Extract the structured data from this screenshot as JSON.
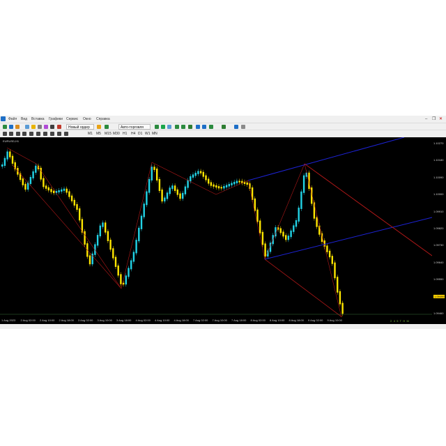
{
  "menu": {
    "items": [
      "Файл",
      "Вид",
      "Вставка",
      "Графики",
      "Сервис",
      "Окно",
      "Справка"
    ]
  },
  "window_controls": {
    "minimize": "–",
    "restore": "❐",
    "close": "✕"
  },
  "toolbar": {
    "new_order_label": "Новый ордер",
    "auto_trading_label": "Авто-торговля",
    "timeframes": [
      "M1",
      "M5",
      "M15",
      "M30",
      "H1",
      "H4",
      "D1",
      "W1",
      "MN"
    ]
  },
  "chart": {
    "symbol_title": "EURUSD,H1",
    "background": "#000000",
    "bull_color": "#22d3e6",
    "bear_color": "#ffe600",
    "channel_color": "#1d23d6",
    "line_color": "#b01818",
    "current_price": "1.09499"
  },
  "price_scale": [
    "1.10270",
    "1.10180",
    "1.10090",
    "1.10000",
    "1.09910",
    "1.09820",
    "1.09730",
    "1.09640",
    "1.09550",
    "1.09499",
    "1.09460"
  ],
  "time_scale": [
    "1 Aug 2023",
    "2 Aug 02:00",
    "2 Aug 10:00",
    "2 Aug 18:00",
    "3 Aug 02:00",
    "3 Aug 10:00",
    "3 Aug 18:00",
    "4 Aug 02:00",
    "4 Aug 10:00",
    "4 Aug 18:00",
    "7 Aug 02:00",
    "7 Aug 10:00",
    "7 Aug 18:00",
    "8 Aug 02:00",
    "8 Aug 10:00",
    "8 Aug 18:00",
    "9 Aug 02:00",
    "9 Aug 10:00"
  ],
  "status": {
    "counters": [
      "Σ",
      "4",
      "5",
      "T",
      "H",
      "M"
    ]
  }
}
